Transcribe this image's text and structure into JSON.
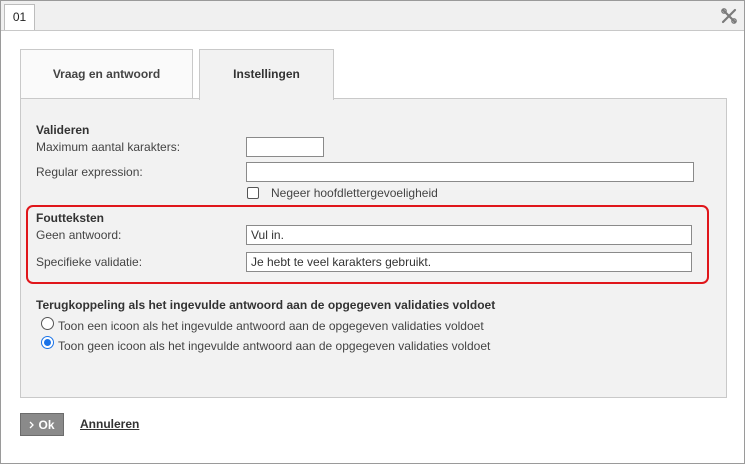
{
  "window": {
    "tab_label": "01",
    "close_icon": "close-icon"
  },
  "tabs": [
    {
      "label": "Vraag en antwoord",
      "active": false
    },
    {
      "label": "Instellingen",
      "active": true
    }
  ],
  "validate": {
    "heading": "Valideren",
    "max_chars_label": "Maximum aantal karakters:",
    "max_chars_value": "",
    "regex_label": "Regular expression:",
    "regex_value": "",
    "ignore_case_label": "Negeer hoofdlettergevoeligheid",
    "ignore_case_checked": false
  },
  "errors": {
    "heading": "Foutteksten",
    "no_answer_label": "Geen antwoord:",
    "no_answer_value": "Vul in.",
    "specific_label": "Specifieke validatie:",
    "specific_value": "Je hebt te veel karakters gebruikt.",
    "highlight_color": "#e0161b"
  },
  "feedback": {
    "heading": "Terugkoppeling als het ingevulde antwoord aan de opgegeven validaties voldoet",
    "options": [
      {
        "label": "Toon een icoon als het ingevulde antwoord aan de opgegeven validaties voldoet",
        "selected": false
      },
      {
        "label": "Toon geen icoon als het ingevulde antwoord aan de opgegeven validaties voldoet",
        "selected": true
      }
    ]
  },
  "actions": {
    "ok_label": "Ok",
    "cancel_label": "Annuleren"
  }
}
